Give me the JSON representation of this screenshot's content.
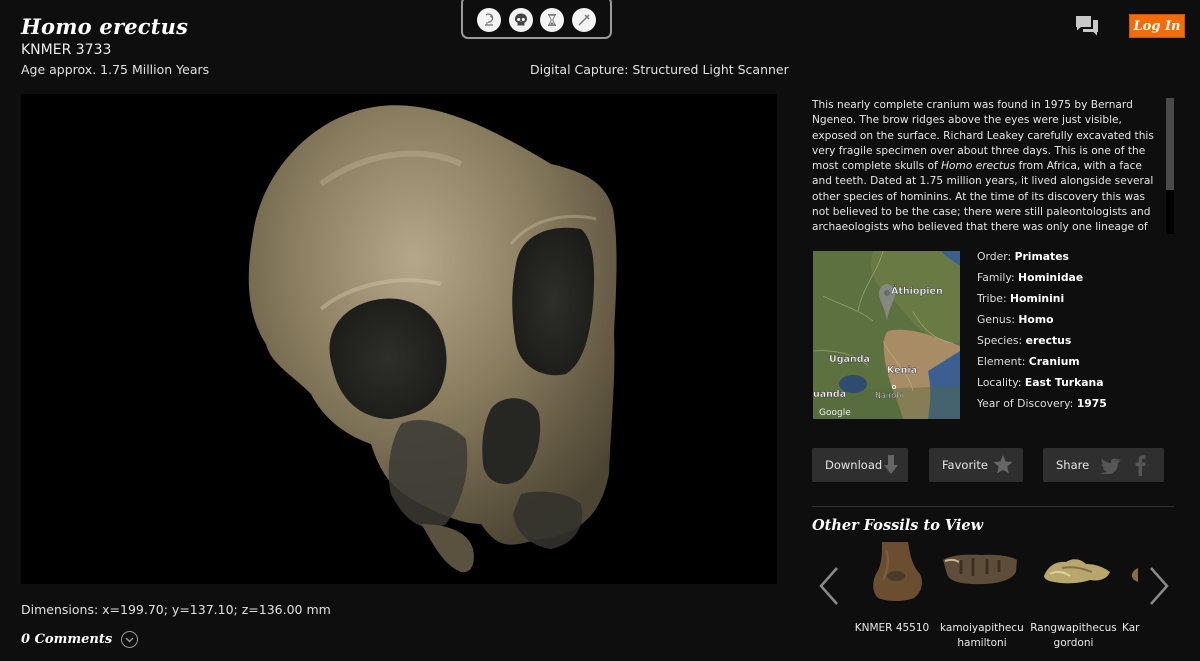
{
  "header": {
    "title": "Homo erectus",
    "specimen_id": "KNMER 3733",
    "age": "Age approx. 1.75 Million Years",
    "capture": "Digital Capture: Structured Light Scanner",
    "login_label": "Log In"
  },
  "toolbar": {
    "tools": [
      {
        "icon": "microscope-icon"
      },
      {
        "icon": "skull-icon"
      },
      {
        "icon": "hourglass-icon"
      },
      {
        "icon": "measure-icon"
      }
    ]
  },
  "viewer": {
    "dimensions": "Dimensions:  x=199.70; y=137.10; z=136.00 mm"
  },
  "comments": {
    "label": "0 Comments"
  },
  "description": {
    "part1": "This nearly complete cranium was found in 1975 by Bernard Ngeneo. The brow ridges above the eyes were just visible, exposed on the surface. Richard Leakey carefully excavated this very fragile specimen over about three days. This is one of the most complete skulls of ",
    "italic": "Homo erectus",
    "part2": " from Africa, with a face and teeth. Dated at 1.75 million years, it lived alongside several other species of hominins. At the time of its discovery this was not believed to be the case; there were still paleontologists and archaeologists who believed that there was only one lineage of",
    "scroll_fraction": 0.0
  },
  "map": {
    "labels": {
      "ethiopia": "Äthiopien",
      "uganda": "Uganda",
      "kenya": "Kenia",
      "rwanda": "uanda",
      "nairobi": "Nairobi",
      "provider": "Google"
    }
  },
  "taxonomy": [
    {
      "key": "Order: ",
      "value": "Primates"
    },
    {
      "key": "Family: ",
      "value": "Hominidae"
    },
    {
      "key": "Tribe: ",
      "value": "Hominini"
    },
    {
      "key": "Genus: ",
      "value": "Homo"
    },
    {
      "key": "Species: ",
      "value": "erectus"
    },
    {
      "key": "Element: ",
      "value": "Cranium"
    },
    {
      "key": "Locality: ",
      "value": "East Turkana"
    },
    {
      "key": "Year of Discovery: ",
      "value": "1975"
    }
  ],
  "actions": {
    "download": "Download",
    "favorite": "Favorite",
    "share": "Share"
  },
  "other_fossils": {
    "heading": "Other Fossils to View",
    "items": [
      {
        "line1": "KNMER 45510",
        "line2": ""
      },
      {
        "line1": "kamoiyapithecus",
        "line2": "hamiltoni"
      },
      {
        "line1": "Rangwapithecus",
        "line2": "gordoni"
      },
      {
        "line1": "Kar",
        "line2": ""
      }
    ]
  },
  "colors": {
    "accent": "#f26d0a",
    "background": "#0e0e0e",
    "button_bg": "#2f2f2f"
  }
}
